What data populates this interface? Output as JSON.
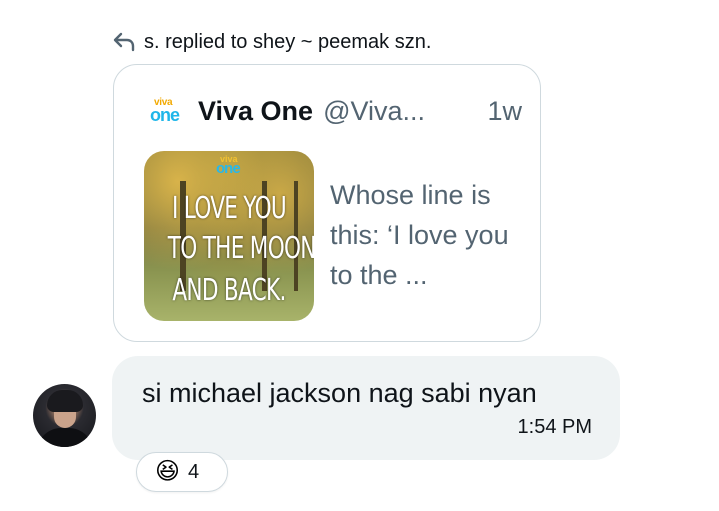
{
  "reply_context": {
    "text": "s. replied to shey ~ peemak szn.",
    "icon": "reply-arrow-icon"
  },
  "quoted_post": {
    "author_name": "Viva One",
    "author_handle": "@Viva...",
    "time": "1w",
    "logo_top": "viva",
    "logo_bottom": "one",
    "image_logo_top": "viva",
    "image_logo_bottom": "one",
    "image_text_line1": "I LOVE YOU",
    "image_text_line2": "TO THE MOON",
    "image_text_line3": "AND BACK.",
    "text": "Whose line is this: ‘I love you to the ..."
  },
  "message": {
    "text": "si michael jackson nag sabi nyan",
    "time": "1:54 PM"
  },
  "reaction": {
    "emoji": "😆",
    "count": "4"
  },
  "colors": {
    "bubble_background": "#eff3f4",
    "card_border": "#cfd9de",
    "secondary_text": "#536471",
    "primary_text": "#0f1419",
    "brand_blue": "#1fb6e9",
    "brand_yellow": "#f2a900"
  }
}
